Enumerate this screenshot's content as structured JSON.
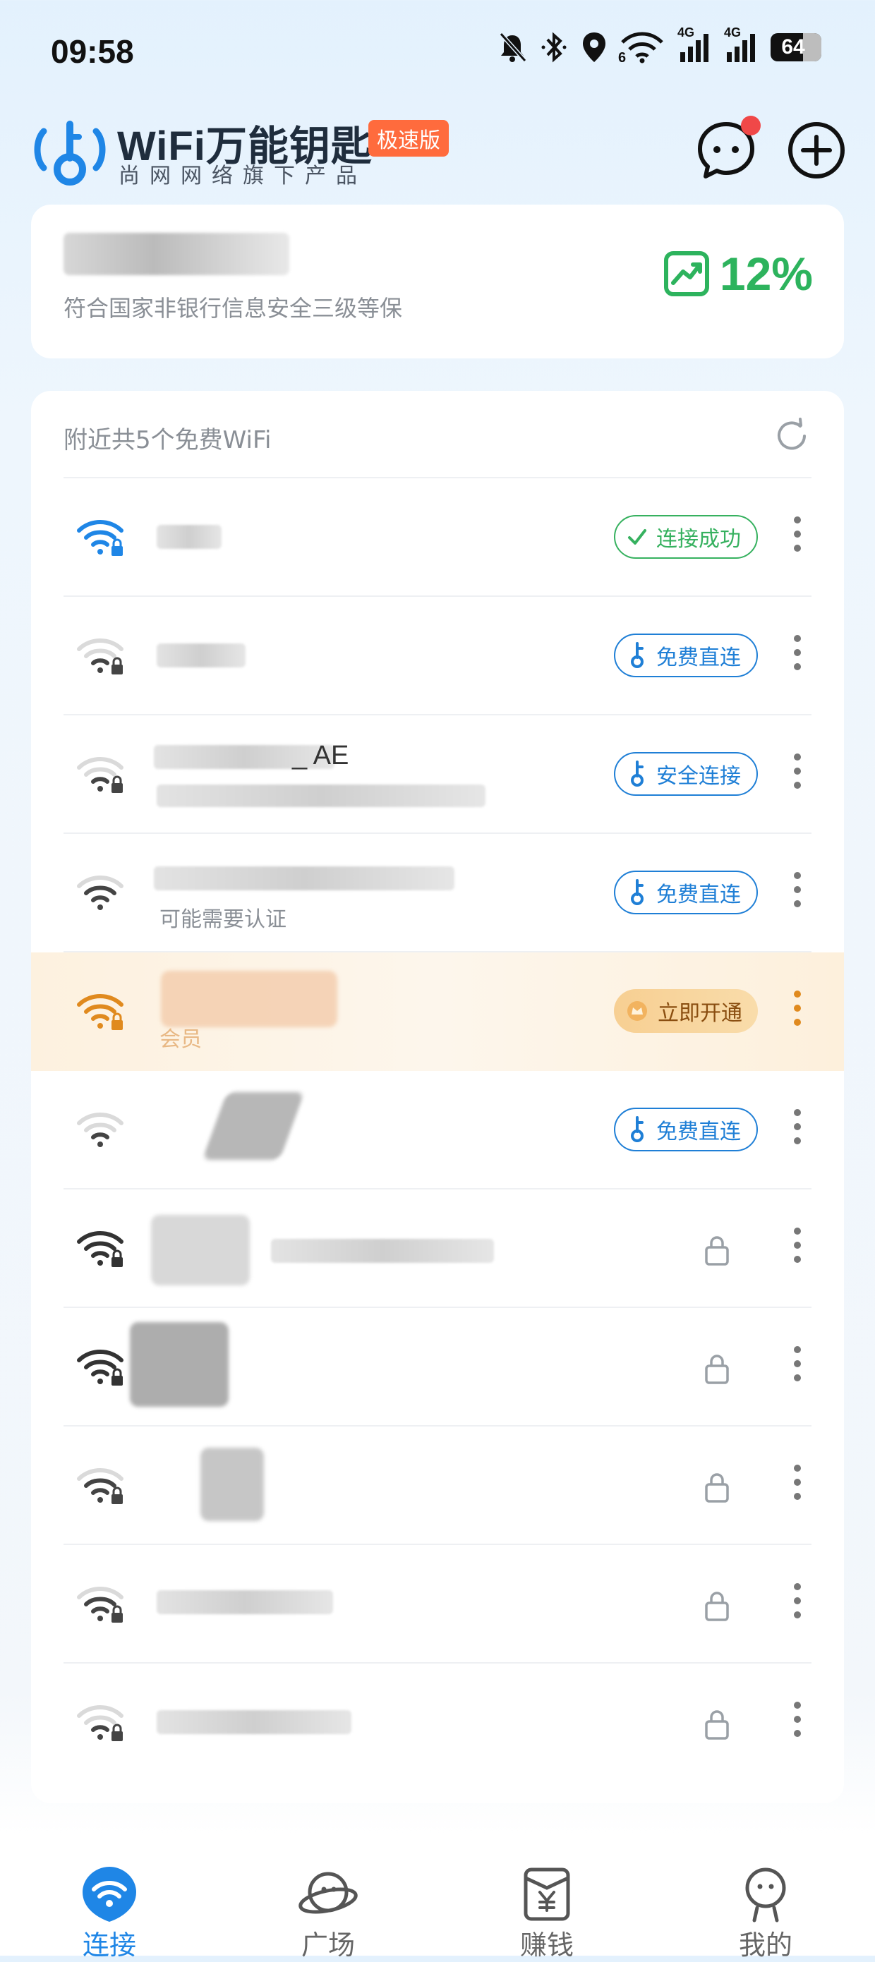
{
  "status_bar": {
    "time": "09:58",
    "battery": "64",
    "network_label_1": "4G",
    "network_label_2": "4G",
    "wifi_index": "6"
  },
  "header": {
    "brand": "WiFi万能钥匙",
    "badge": "极速版",
    "subtitle": "尚网网络旗下产品"
  },
  "security": {
    "description": "符合国家非银行信息安全三级等保",
    "percent": "12%"
  },
  "wifi_list": {
    "count_label": "附近共5个免费WiFi",
    "rows": [
      {
        "action": "连接成功",
        "type": "success"
      },
      {
        "action": "免费直连",
        "type": "key"
      },
      {
        "name": "_ AE",
        "action": "安全连接",
        "type": "key"
      },
      {
        "sub": "可能需要认证",
        "action": "免费直连",
        "type": "key"
      },
      {
        "sub": "会员",
        "action": "立即开通",
        "type": "vip"
      },
      {
        "action": "免费直连",
        "type": "key"
      },
      {
        "type": "lock"
      },
      {
        "type": "lock"
      },
      {
        "type": "lock"
      },
      {
        "type": "lock"
      },
      {
        "type": "lock"
      }
    ]
  },
  "bottom_nav": {
    "items": [
      {
        "label": "连接",
        "active": true,
        "icon": "wifi-nav-icon"
      },
      {
        "label": "广场",
        "active": false,
        "icon": "planet-icon"
      },
      {
        "label": "赚钱",
        "active": false,
        "icon": "money-bag-icon"
      },
      {
        "label": "我的",
        "active": false,
        "icon": "profile-icon"
      }
    ]
  },
  "colors": {
    "accent_blue": "#1f7fd6",
    "success_green": "#36b15f",
    "vip_orange": "#e08a1e",
    "badge_orange": "#ff6b3d"
  }
}
